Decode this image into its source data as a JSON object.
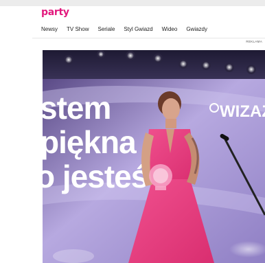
{
  "header": {
    "logo": "party"
  },
  "nav": {
    "items": [
      "Newsy",
      "TV Show",
      "Seriale",
      "Styl Gwiazd",
      "Wideo",
      "Gwiazdy"
    ]
  },
  "ad": {
    "label": "REKLAMA"
  },
  "photo": {
    "backdrop_lines": [
      "stem",
      "piękna",
      "o jesteś"
    ],
    "sponsor_logo": "WIZAŻ",
    "colors": {
      "dress": "#e8407f",
      "backdrop": "#b3a7dd",
      "stage": "#2b2645"
    }
  }
}
